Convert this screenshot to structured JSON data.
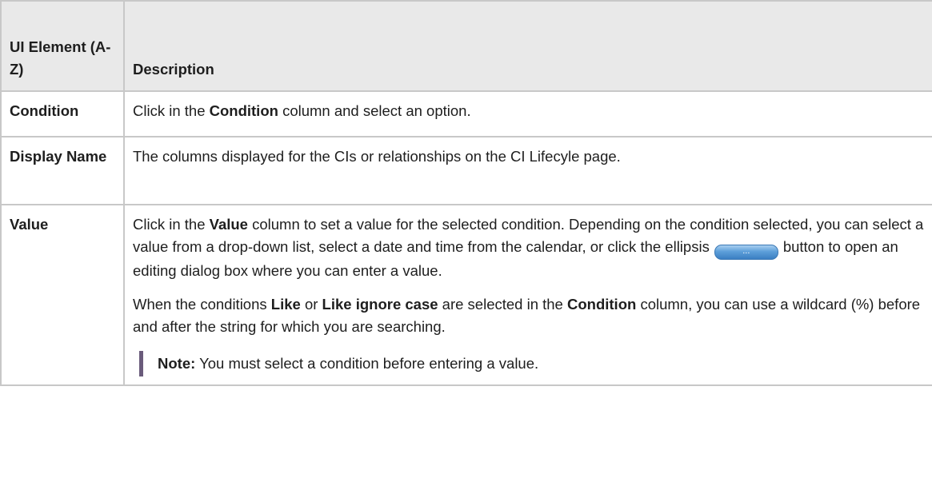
{
  "table": {
    "header": {
      "col1": "UI Element (A-Z)",
      "col2": "Description"
    },
    "rows": [
      {
        "name": "Condition",
        "desc_pre": "Click in the ",
        "desc_bold": "Condition",
        "desc_post": " column and select an option."
      },
      {
        "name": "Display Name",
        "desc": "The columns displayed for the CIs or relationships on the CI Lifecyle page."
      },
      {
        "name": "Value",
        "p1_pre": "Click in the ",
        "p1_bold": "Value",
        "p1_mid": " column to set a value for the selected condition. Depending on the condition selected, you can select a value from a drop-down list, select a date and time from the calendar, or click the ellipsis",
        "p1_button": "...",
        "p1_post": "button to open an editing dialog box where you can enter a value.",
        "p2_pre": "When the conditions ",
        "p2_bold1": "Like",
        "p2_or": " or ",
        "p2_bold2": "Like ignore case",
        "p2_mid": " are selected in the ",
        "p2_bold3": "Condition",
        "p2_post": " column, you can use a wildcard (%) before and after the string for which you are searching.",
        "note_label": "Note:",
        "note_text": " You must select a condition before entering a value."
      }
    ]
  }
}
